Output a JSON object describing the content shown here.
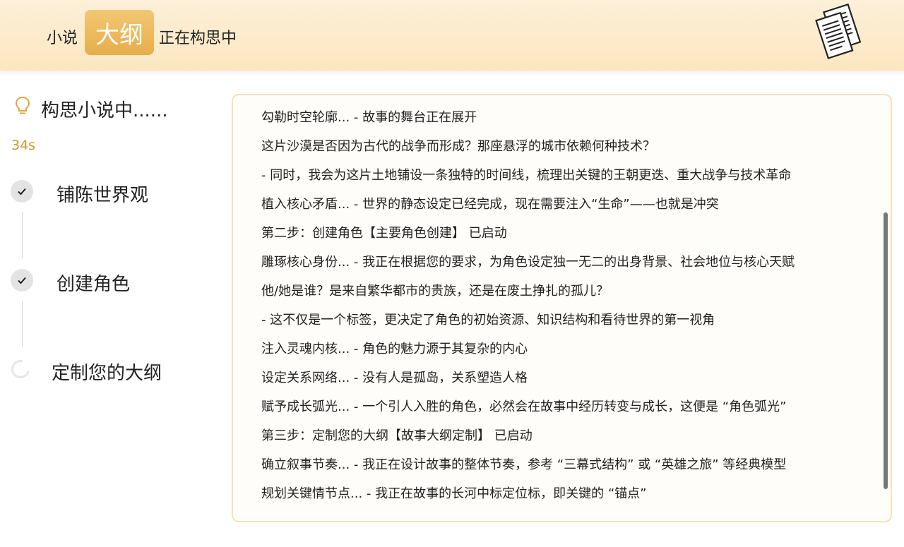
{
  "header": {
    "word1": "小说",
    "badge": "大纲",
    "word2": "正在构思中",
    "icon": "documents-icon"
  },
  "sidebar": {
    "title": "构思小说中......",
    "timer": "34s",
    "steps": [
      {
        "label": "铺陈世界观",
        "status": "done"
      },
      {
        "label": "创建角色",
        "status": "done"
      },
      {
        "label": "定制您的大纲",
        "status": "in-progress"
      }
    ]
  },
  "log": {
    "lines": [
      "勾勒时空轮廓... - 故事的舞台正在展开",
      "这片沙漠是否因为古代的战争而形成？那座悬浮的城市依赖何种技术？",
      "- 同时，我会为这片土地铺设一条独特的时间线，梳理出关键的王朝更迭、重大战争与技术革命",
      "植入核心矛盾... - 世界的静态设定已经完成，现在需要注入“生命”——也就是冲突",
      "第二步：创建角色【主要角色创建】 已启动",
      "雕琢核心身份... - 我正在根据您的要求，为角色设定独一无二的出身背景、社会地位与核心天赋",
      "他/她是谁？是来自繁华都市的贵族，还是在废土挣扎的孤儿？",
      "- 这不仅是一个标签，更决定了角色的初始资源、知识结构和看待世界的第一视角",
      "注入灵魂内核... - 角色的魅力源于其复杂的内心",
      "设定关系网络... - 没有人是孤岛，关系塑造人格",
      "赋予成长弧光... - 一个引人入胜的角色，必然会在故事中经历转变与成长，这便是 “角色弧光”",
      "第三步：定制您的大纲【故事大纲定制】 已启动",
      "确立叙事节奏... - 我正在设计故事的整体节奏，参考 “三幕式结构” 或 “英雄之旅” 等经典模型",
      "规划关键情节点... - 我正在故事的长河中标定位标，即关键的 “锚点”"
    ]
  },
  "colors": {
    "accent": "#e7ad4b",
    "timer": "#d4942a",
    "panel_border": "#f8e3b4",
    "header_bg": "#fbe6c0"
  }
}
